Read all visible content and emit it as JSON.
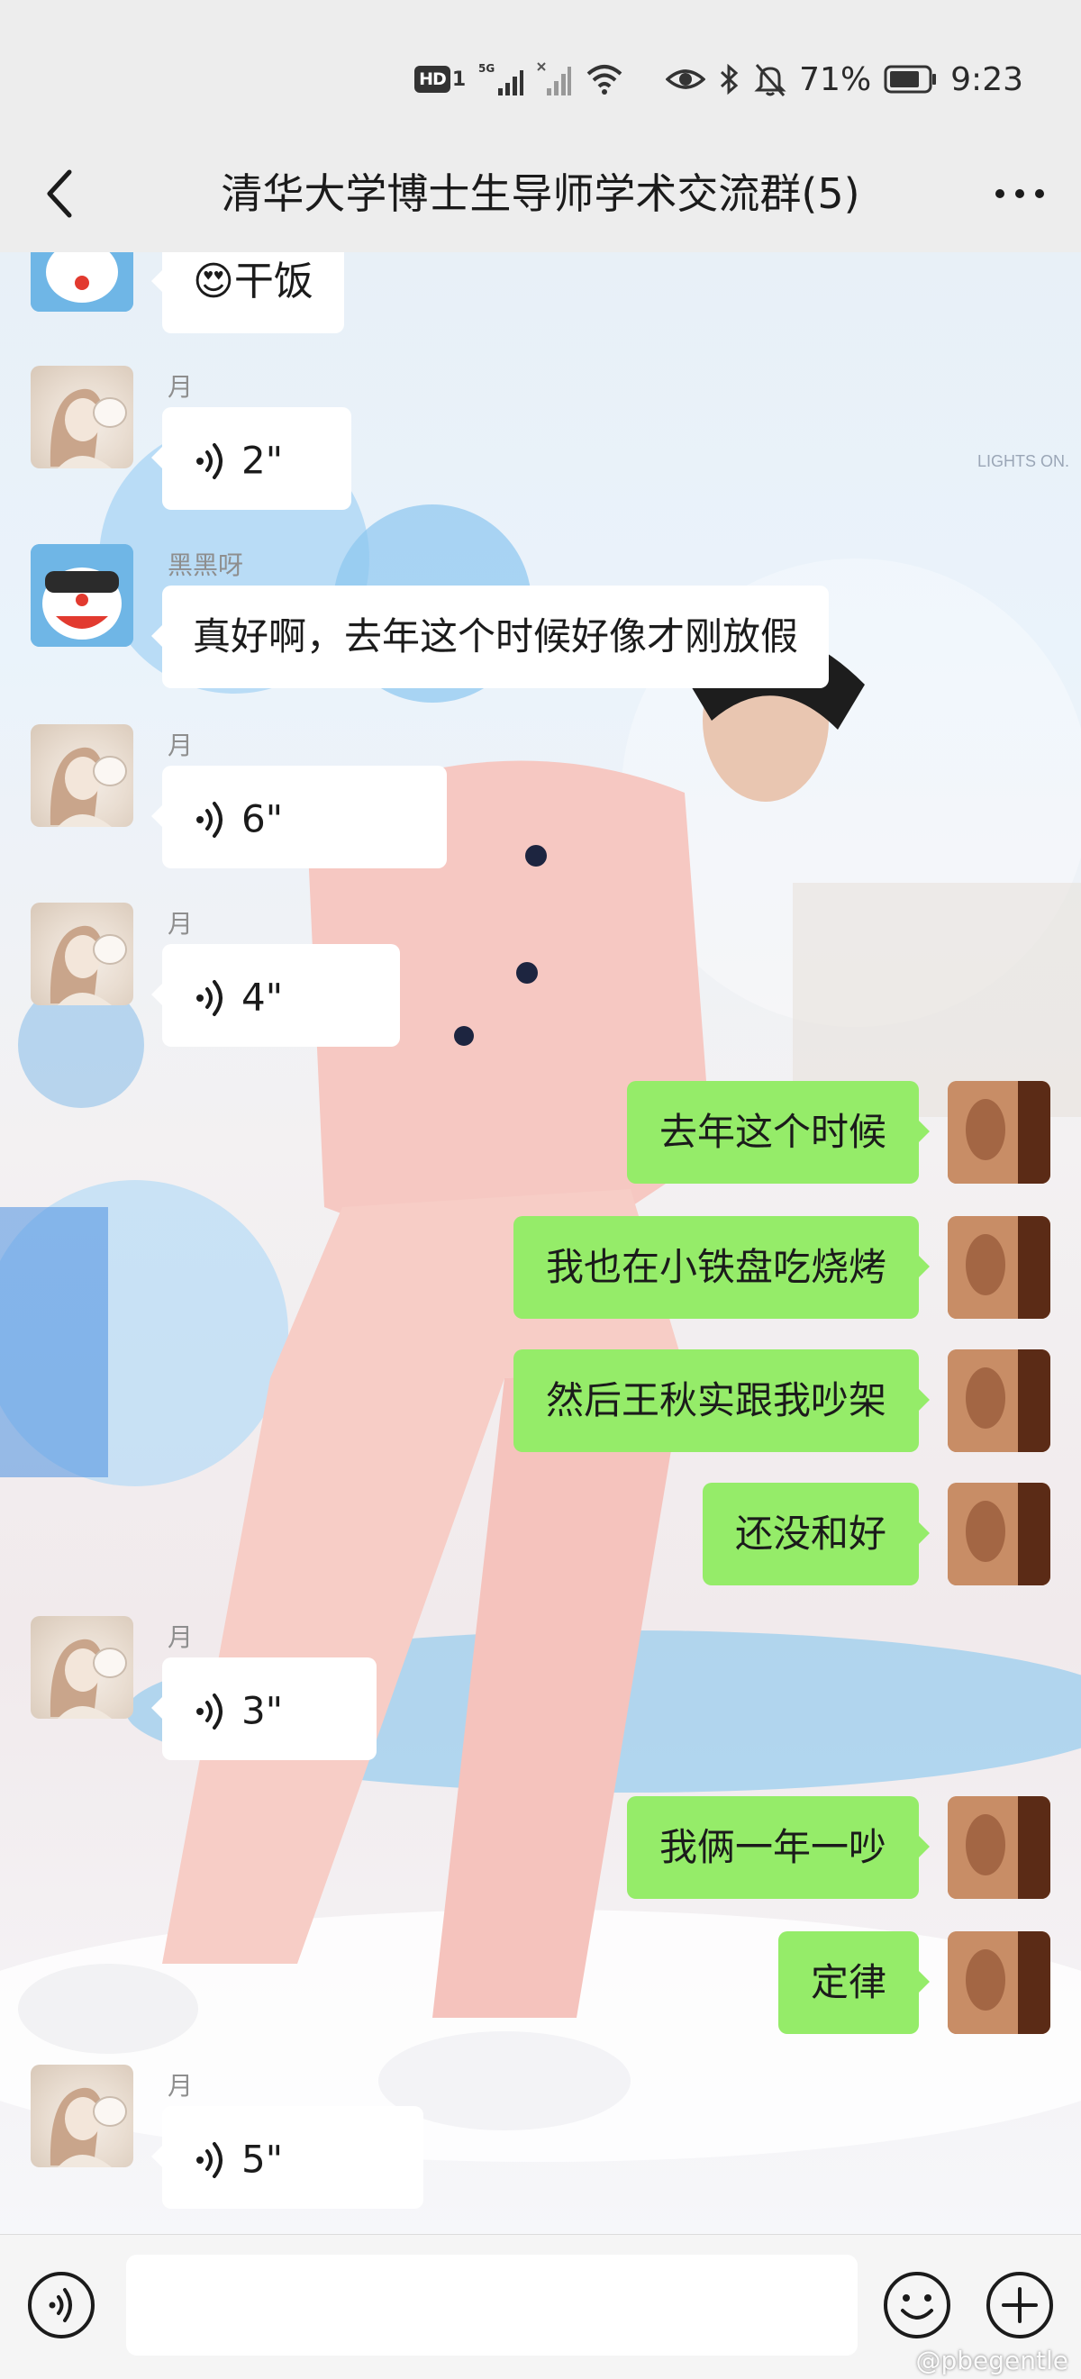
{
  "status_bar": {
    "hd_label": "HD",
    "hd_num": "1",
    "signal_label": "5G",
    "battery": "71%",
    "time": "9:23"
  },
  "header": {
    "title": "清华大学博士生导师学术交流群(5)"
  },
  "messages": [
    {
      "side": "in",
      "sender": "",
      "avatar": "doraemon",
      "type": "text",
      "text": "😍干饭"
    },
    {
      "side": "in",
      "sender": "月",
      "avatar": "yue",
      "type": "voice",
      "duration": "2\""
    },
    {
      "side": "in",
      "sender": "黑黑呀",
      "avatar": "doraemon",
      "type": "text",
      "text": "真好啊，去年这个时候好像才刚放假"
    },
    {
      "side": "in",
      "sender": "月",
      "avatar": "yue",
      "type": "voice",
      "duration": "6\""
    },
    {
      "side": "in",
      "sender": "月",
      "avatar": "yue",
      "type": "voice",
      "duration": "4\""
    },
    {
      "side": "out",
      "avatar": "me",
      "type": "text",
      "text": "去年这个时候"
    },
    {
      "side": "out",
      "avatar": "me",
      "type": "text",
      "text": "我也在小铁盘吃烧烤"
    },
    {
      "side": "out",
      "avatar": "me",
      "type": "text",
      "text": "然后王秋实跟我吵架"
    },
    {
      "side": "out",
      "avatar": "me",
      "type": "text",
      "text": "还没和好"
    },
    {
      "side": "in",
      "sender": "月",
      "avatar": "yue",
      "type": "voice",
      "duration": "3\""
    },
    {
      "side": "out",
      "avatar": "me",
      "type": "text",
      "text": "我俩一年一吵"
    },
    {
      "side": "out",
      "avatar": "me",
      "type": "text",
      "text": "定律"
    },
    {
      "side": "in",
      "sender": "月",
      "avatar": "yue",
      "type": "voice",
      "duration": "5\""
    }
  ],
  "background": {
    "corner_text": "LIGHTS ON."
  },
  "input_bar": {
    "voice_icon": "voice-mode-icon",
    "emoji_icon": "emoji-icon",
    "plus_icon": "plus-icon"
  },
  "watermark": "@pbegentle",
  "colors": {
    "bubble_out": "#95ec69",
    "bubble_in": "#ffffff",
    "bar_bg": "#ededed"
  }
}
